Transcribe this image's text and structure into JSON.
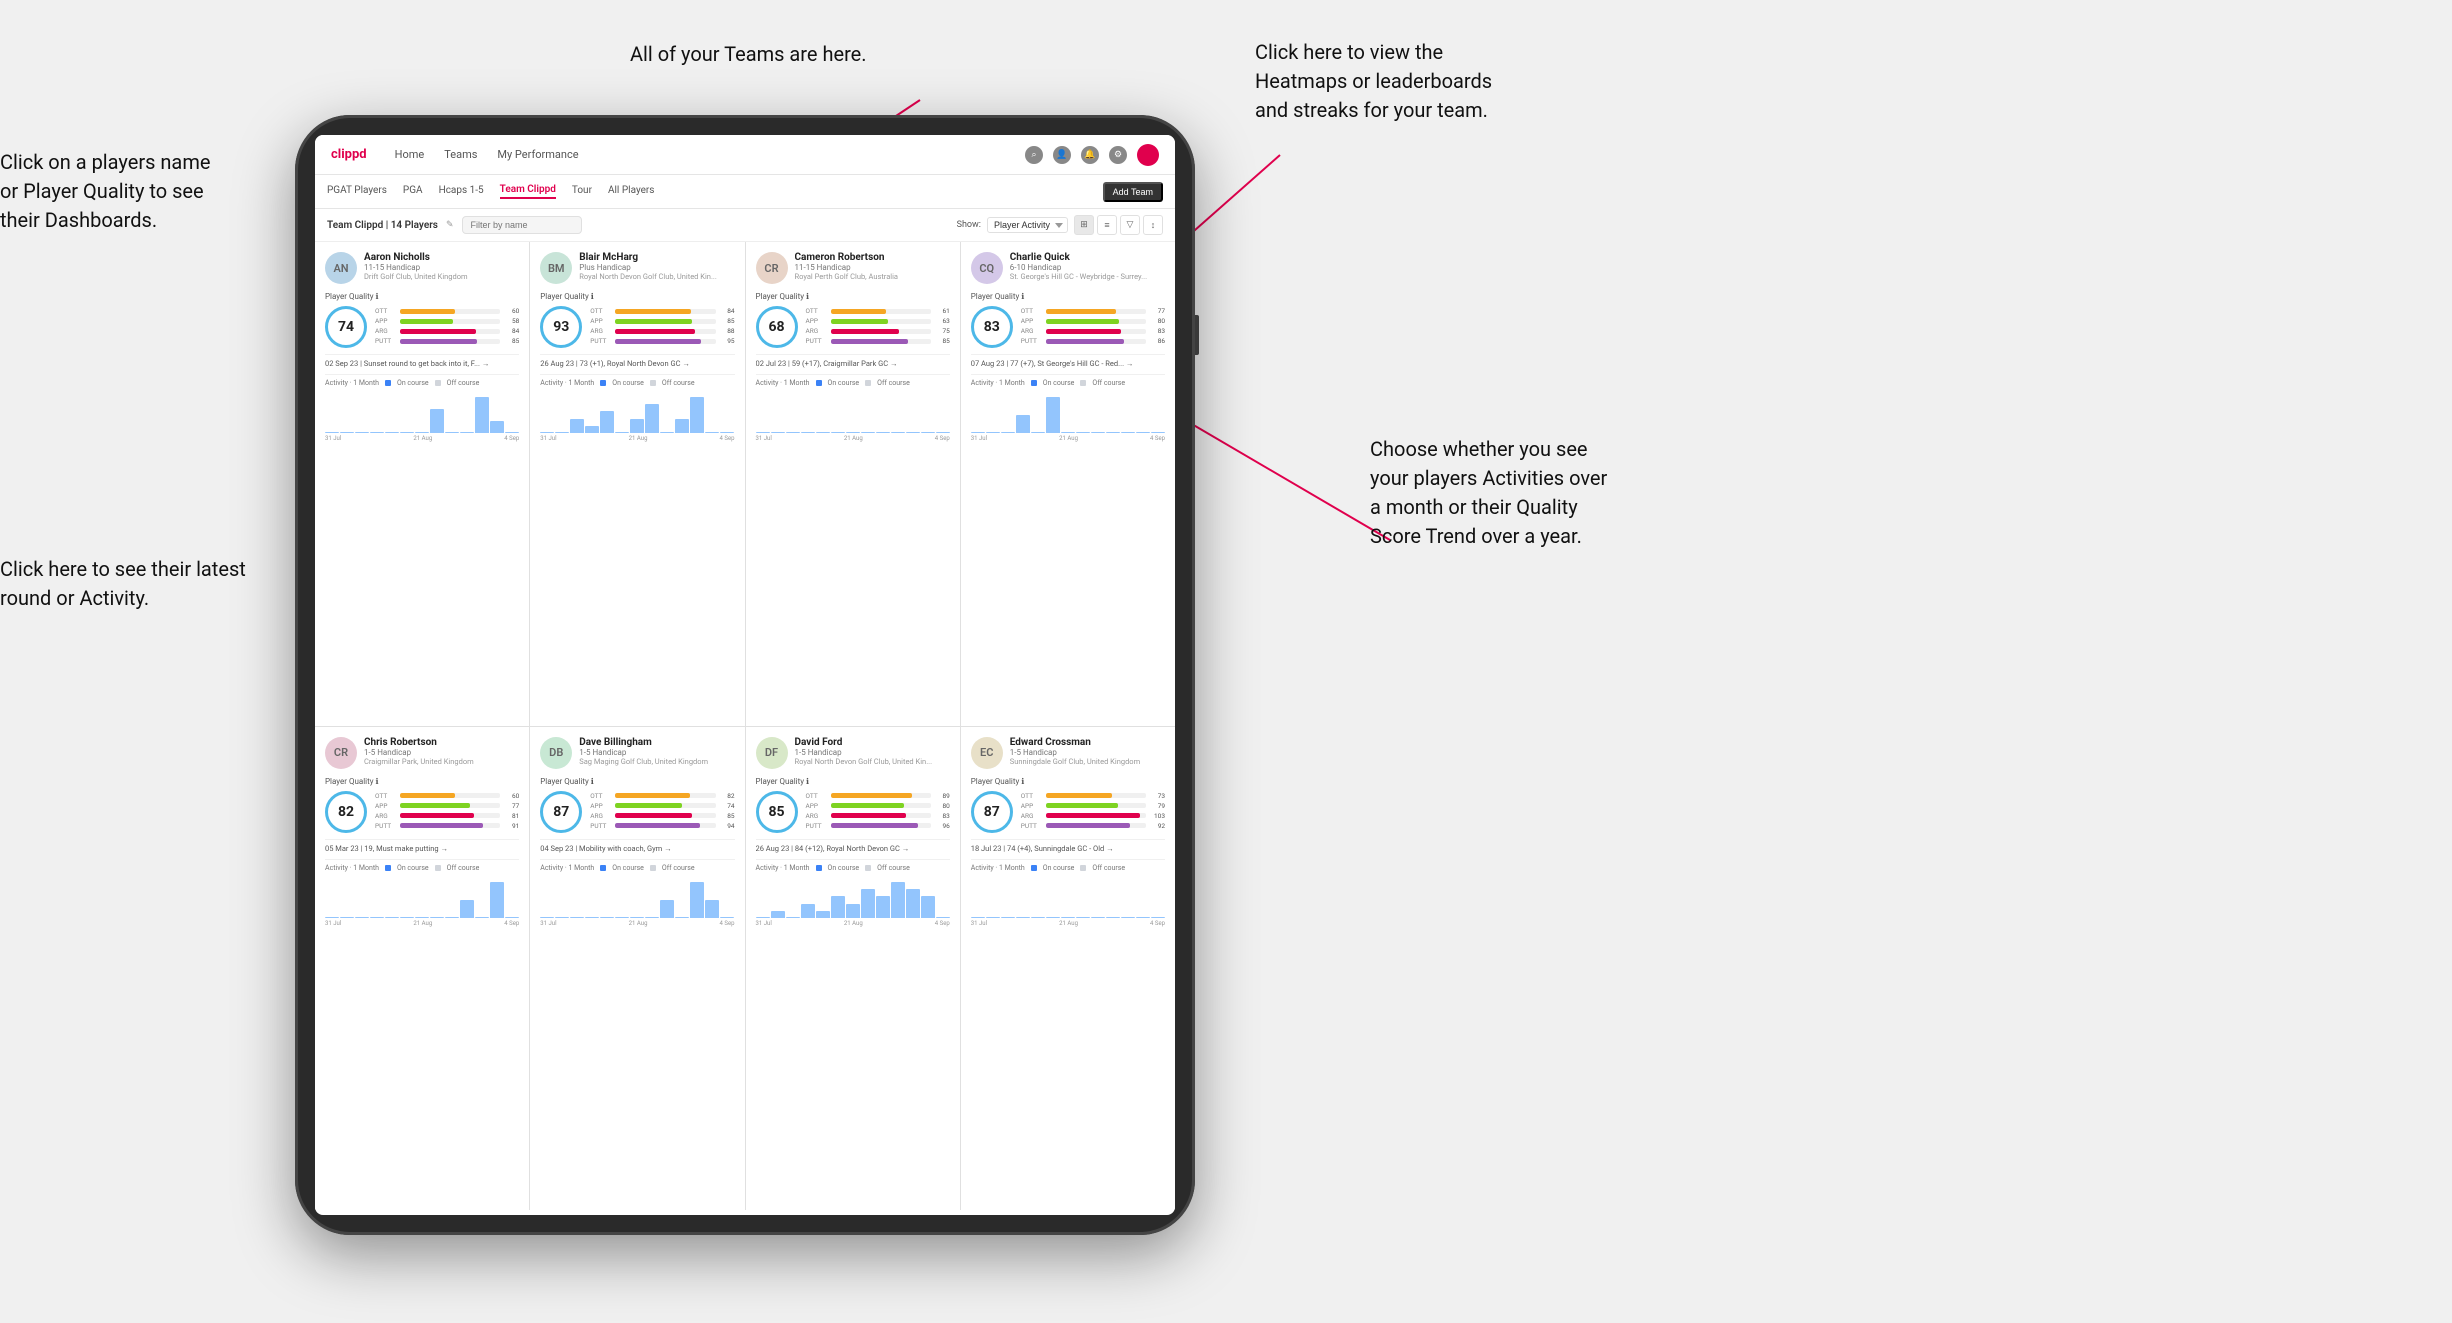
{
  "annotations": {
    "teams_tooltip": "All of your Teams are here.",
    "heatmaps_tooltip": "Click here to view the\nHeatmaps or leaderboards\nand streaks for your team.",
    "player_name_tooltip": "Click on a players name\nor Player Quality to see\ntheir Dashboards.",
    "activities_tooltip": "Choose whether you see\nyour players Activities over\na month or their Quality\nScore Trend over a year.",
    "latest_round_tooltip": "Click here to see their latest\nround or Activity."
  },
  "nav": {
    "logo": "clippd",
    "links": [
      "Home",
      "Teams",
      "My Performance"
    ],
    "add_team_btn": "Add Team"
  },
  "sub_nav": {
    "links": [
      "PGAT Players",
      "PGA",
      "Hcaps 1-5",
      "Team Clippd",
      "Tour",
      "All Players"
    ]
  },
  "toolbar": {
    "title": "Team Clippd | 14 Players",
    "search_placeholder": "Filter by name",
    "show_label": "Show:",
    "show_option": "Player Activity",
    "view_modes": [
      "grid",
      "list",
      "filter",
      "sort"
    ]
  },
  "players": [
    {
      "name": "Aaron Nicholls",
      "handicap": "11-15 Handicap",
      "club": "Drift Golf Club, United Kingdom",
      "quality": 74,
      "ott": 60,
      "app": 58,
      "arg": 84,
      "putt": 85,
      "latest_date": "02 Sep 23",
      "latest_text": "Sunset round to get back into it, F... →",
      "chart_bars": [
        0,
        0,
        0,
        0,
        0,
        0,
        0,
        2,
        0,
        0,
        3,
        1,
        0
      ],
      "x_labels": [
        "31 Jul",
        "21 Aug",
        "4 Sep"
      ]
    },
    {
      "name": "Blair McHarg",
      "handicap": "Plus Handicap",
      "club": "Royal North Devon Golf Club, United Kin...",
      "quality": 93,
      "ott": 84,
      "app": 85,
      "arg": 88,
      "putt": 95,
      "latest_date": "26 Aug 23",
      "latest_text": "73 (+1), Royal North Devon GC →",
      "chart_bars": [
        0,
        0,
        2,
        1,
        3,
        0,
        2,
        4,
        0,
        2,
        5,
        0,
        0
      ],
      "x_labels": [
        "31 Jul",
        "21 Aug",
        "4 Sep"
      ]
    },
    {
      "name": "Cameron Robertson",
      "handicap": "11-15 Handicap",
      "club": "Royal Perth Golf Club, Australia",
      "quality": 68,
      "ott": 61,
      "app": 63,
      "arg": 75,
      "putt": 85,
      "latest_date": "02 Jul 23",
      "latest_text": "59 (+17), Craigmillar Park GC →",
      "chart_bars": [
        0,
        0,
        0,
        0,
        0,
        0,
        0,
        0,
        0,
        0,
        0,
        0,
        0
      ],
      "x_labels": [
        "31 Jul",
        "21 Aug",
        "4 Sep"
      ]
    },
    {
      "name": "Charlie Quick",
      "handicap": "6-10 Handicap",
      "club": "St. George's Hill GC - Weybridge - Surrey...",
      "quality": 83,
      "ott": 77,
      "app": 80,
      "arg": 83,
      "putt": 86,
      "latest_date": "07 Aug 23",
      "latest_text": "77 (+7), St George's Hill GC - Red... →",
      "chart_bars": [
        0,
        0,
        0,
        1,
        0,
        2,
        0,
        0,
        0,
        0,
        0,
        0,
        0
      ],
      "x_labels": [
        "31 Jul",
        "21 Aug",
        "4 Sep"
      ]
    },
    {
      "name": "Chris Robertson",
      "handicap": "1-5 Handicap",
      "club": "Craigmillar Park, United Kingdom",
      "quality": 82,
      "ott": 60,
      "app": 77,
      "arg": 81,
      "putt": 91,
      "latest_date": "05 Mar 23",
      "latest_text": "19, Must make putting →",
      "chart_bars": [
        0,
        0,
        0,
        0,
        0,
        0,
        0,
        0,
        0,
        1,
        0,
        2,
        0
      ],
      "x_labels": [
        "31 Jul",
        "21 Aug",
        "4 Sep"
      ]
    },
    {
      "name": "Dave Billingham",
      "handicap": "1-5 Handicap",
      "club": "Sag Maging Golf Club, United Kingdom",
      "quality": 87,
      "ott": 82,
      "app": 74,
      "arg": 85,
      "putt": 94,
      "latest_date": "04 Sep 23",
      "latest_text": "Mobility with coach, Gym →",
      "chart_bars": [
        0,
        0,
        0,
        0,
        0,
        0,
        0,
        0,
        1,
        0,
        2,
        1,
        0
      ],
      "x_labels": [
        "31 Jul",
        "21 Aug",
        "4 Sep"
      ]
    },
    {
      "name": "David Ford",
      "handicap": "1-5 Handicap",
      "club": "Royal North Devon Golf Club, United Kin...",
      "quality": 85,
      "ott": 89,
      "app": 80,
      "arg": 83,
      "putt": 96,
      "latest_date": "26 Aug 23",
      "latest_text": "84 (+12), Royal North Devon GC →",
      "chart_bars": [
        0,
        1,
        0,
        2,
        1,
        3,
        2,
        4,
        3,
        5,
        4,
        3,
        0
      ],
      "x_labels": [
        "31 Jul",
        "21 Aug",
        "4 Sep"
      ]
    },
    {
      "name": "Edward Crossman",
      "handicap": "1-5 Handicap",
      "club": "Sunningdale Golf Club, United Kingdom",
      "quality": 87,
      "ott": 73,
      "app": 79,
      "arg": 103,
      "putt": 92,
      "latest_date": "18 Jul 23",
      "latest_text": "74 (+4), Sunningdale GC - Old →",
      "chart_bars": [
        0,
        0,
        0,
        0,
        0,
        0,
        0,
        0,
        0,
        0,
        0,
        0,
        0
      ],
      "x_labels": [
        "31 Jul",
        "21 Aug",
        "4 Sep"
      ]
    }
  ]
}
